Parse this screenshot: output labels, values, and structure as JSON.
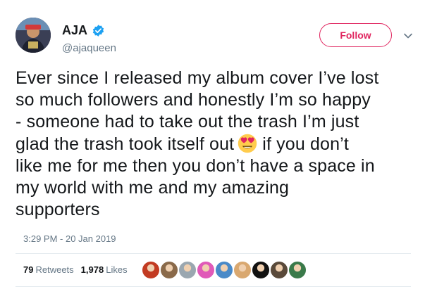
{
  "user": {
    "display_name": "AJA",
    "handle": "@ajaqueen",
    "avatar_icon": "avatar-photo",
    "verified_icon": "verified-badge-icon",
    "verified_color": "#1da1f2"
  },
  "follow_button": {
    "label": "Follow",
    "color": "#e0245e"
  },
  "menu_icon": "chevron-down-icon",
  "tweet": {
    "lines": [
      "Ever since I released my album cover I’ve lost",
      "so much followers and honestly I’m so happy",
      "- someone had to take out the trash I’m just",
      "glad the trash took itself out",
      "if you don’t",
      "like me for me then you don’t have a space in",
      "my world with me and my amazing",
      "supporters"
    ],
    "emoji": "heart-eyes-emoji"
  },
  "timestamp": "3:29 PM - 20 Jan 2019",
  "stats": {
    "retweets_count": "79",
    "retweets_label": "Retweets",
    "likes_count": "1,978",
    "likes_label": "Likes"
  },
  "likers": [
    "#c23b22",
    "#8a6a4a",
    "#9aa7b0",
    "#e05ab8",
    "#4a8ac8",
    "#d9a870",
    "#111111",
    "#5a4a3a",
    "#3a7a4a"
  ]
}
